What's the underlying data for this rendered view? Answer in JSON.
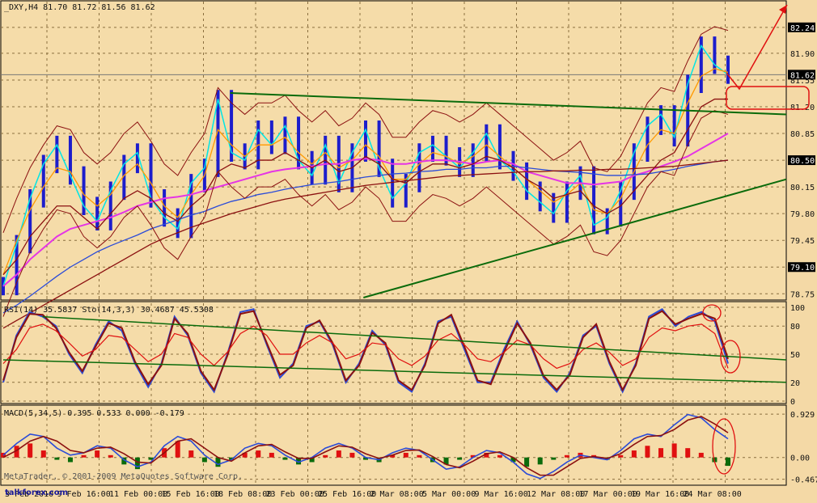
{
  "chart_data": [
    {
      "type": "line",
      "panel": "price",
      "title": "_DXY,H4  81.70 81.72 81.56 81.62",
      "y_ticks": [
        "82.24",
        "81.90",
        "81.55",
        "81.20",
        "80.85",
        "80.50",
        "80.15",
        "79.80",
        "79.45",
        "79.10",
        "78.75"
      ],
      "ylim": [
        78.7,
        82.45
      ],
      "current_price": "81.62",
      "marked_levels": [
        "82.24",
        "81.10",
        "80.50",
        "79.10"
      ],
      "x_labels": [
        "3 Feb 2010",
        "9 Feb 16:00",
        "11 Feb 00:00",
        "15 Feb 16:00",
        "18 Feb 08:00",
        "23 Feb 00:00",
        "25 Feb 16:00",
        "2 Mar 08:00",
        "5 Mar 00:00",
        "9 Mar 16:00",
        "12 Mar 08:00",
        "17 Mar 00:00",
        "19 Mar 16:00",
        "24 Mar 08:00"
      ],
      "series": [
        {
          "values": [
            78.85,
            79.4,
            80.0,
            80.45,
            80.7,
            80.3,
            79.9,
            79.7,
            80.1,
            80.45,
            80.6,
            80.0,
            79.75,
            79.6,
            80.2,
            80.4,
            81.3,
            80.6,
            80.5,
            80.9,
            80.7,
            80.95,
            80.5,
            80.3,
            80.7,
            80.2,
            80.6,
            80.9,
            80.4,
            80.0,
            80.2,
            80.6,
            80.7,
            80.55,
            80.4,
            80.6,
            80.85,
            80.5,
            80.35,
            80.1,
            79.95,
            79.8,
            80.1,
            80.3,
            79.65,
            79.75,
            80.1,
            80.6,
            80.95,
            81.1,
            80.8,
            81.5,
            82.0,
            81.75,
            81.62
          ]
        },
        {
          "values": [
            79.0,
            79.45,
            79.85,
            80.15,
            80.4,
            80.35,
            80.05,
            79.9,
            80.05,
            80.3,
            80.45,
            80.2,
            79.9,
            79.75,
            80.05,
            80.3,
            80.9,
            80.7,
            80.55,
            80.7,
            80.7,
            80.8,
            80.6,
            80.45,
            80.6,
            80.4,
            80.5,
            80.7,
            80.55,
            80.25,
            80.25,
            80.45,
            80.6,
            80.55,
            80.45,
            80.55,
            80.7,
            80.55,
            80.4,
            80.25,
            80.1,
            79.95,
            80.05,
            80.2,
            79.85,
            79.8,
            80.0,
            80.35,
            80.7,
            80.9,
            80.85,
            81.25,
            81.6,
            81.7,
            81.65
          ]
        },
        {
          "values": [
            78.85,
            79.0,
            79.2,
            79.35,
            79.5,
            79.6,
            79.65,
            79.7,
            79.75,
            79.82,
            79.9,
            79.95,
            80.0,
            80.02,
            80.05,
            80.1,
            80.15,
            80.2,
            80.25,
            80.3,
            80.35,
            80.38,
            80.4,
            80.42,
            80.45,
            80.45,
            80.5,
            80.52,
            80.5,
            80.45,
            80.45,
            80.48,
            80.5,
            80.5,
            80.48,
            80.45,
            80.48,
            80.5,
            80.45,
            80.35,
            80.3,
            80.25,
            80.2,
            80.2,
            80.18,
            80.2,
            80.22,
            80.3,
            80.35,
            80.42,
            80.48,
            80.55,
            80.65,
            80.75,
            80.85
          ]
        },
        {
          "values": [
            78.5,
            78.6,
            78.72,
            78.85,
            78.98,
            79.1,
            79.2,
            79.3,
            79.38,
            79.45,
            79.52,
            79.6,
            79.66,
            79.72,
            79.78,
            79.83,
            79.9,
            79.96,
            80.0,
            80.05,
            80.08,
            80.12,
            80.15,
            80.18,
            80.2,
            80.22,
            80.25,
            80.28,
            80.3,
            80.32,
            80.33,
            80.35,
            80.36,
            80.38,
            80.38,
            80.4,
            80.4,
            80.42,
            80.42,
            80.4,
            80.38,
            80.36,
            80.35,
            80.34,
            80.32,
            80.3,
            80.3,
            80.31,
            80.32,
            80.35,
            80.38,
            80.42,
            80.45,
            80.48,
            80.5
          ]
        },
        {
          "values": [
            78.3,
            78.4,
            78.5,
            78.6,
            78.7,
            78.8,
            78.9,
            79.0,
            79.1,
            79.2,
            79.3,
            79.4,
            79.48,
            79.55,
            79.62,
            79.68,
            79.74,
            79.8,
            79.85,
            79.9,
            79.95,
            79.99,
            80.02,
            80.05,
            80.08,
            80.11,
            80.14,
            80.17,
            80.19,
            80.21,
            80.23,
            80.25,
            80.27,
            80.29,
            80.3,
            80.31,
            80.32,
            80.33,
            80.34,
            80.35,
            80.35,
            80.36,
            80.36,
            80.37,
            80.37,
            80.38,
            80.38,
            80.39,
            80.4,
            80.41,
            80.42,
            80.44,
            80.46,
            80.48,
            80.5
          ]
        },
        {
          "values": [
            79.0,
            79.2,
            79.5,
            79.7,
            79.9,
            79.9,
            79.75,
            79.6,
            79.8,
            80.0,
            80.1,
            80.0,
            79.8,
            79.7,
            79.9,
            80.05,
            80.35,
            80.45,
            80.4,
            80.5,
            80.5,
            80.6,
            80.5,
            80.4,
            80.5,
            80.35,
            80.4,
            80.55,
            80.45,
            80.25,
            80.2,
            80.35,
            80.45,
            80.45,
            80.4,
            80.45,
            80.55,
            80.5,
            80.4,
            80.25,
            80.15,
            80.0,
            80.05,
            80.1,
            79.9,
            79.8,
            79.9,
            80.1,
            80.3,
            80.5,
            80.6,
            80.9,
            81.2,
            81.3,
            81.3
          ]
        }
      ],
      "trendlines": [
        {
          "from": [
            0.29,
            81.38
          ],
          "to": [
            1.0,
            81.1
          ]
        },
        {
          "from": [
            0.46,
            78.7
          ],
          "to": [
            1.0,
            80.25
          ]
        }
      ]
    },
    {
      "type": "line",
      "panel": "rsi_stoch",
      "title": "RSI(14) 35.5837  Sto(14,3,3) 30.4687 45.5308",
      "y_ticks": [
        "100",
        "80",
        "50",
        "20",
        "0"
      ],
      "ylim": [
        0,
        100
      ],
      "series": [
        {
          "values": [
            20,
            70,
            95,
            90,
            80,
            50,
            30,
            60,
            85,
            75,
            40,
            15,
            40,
            90,
            70,
            30,
            10,
            50,
            95,
            98,
            60,
            25,
            40,
            80,
            85,
            60,
            20,
            40,
            75,
            60,
            20,
            10,
            40,
            85,
            90,
            55,
            20,
            20,
            55,
            85,
            60,
            25,
            10,
            30,
            70,
            80,
            40,
            10,
            40,
            90,
            98,
            80,
            90,
            95,
            85,
            40
          ]
        },
        {
          "values": [
            22,
            68,
            93,
            92,
            78,
            52,
            32,
            58,
            83,
            78,
            42,
            18,
            38,
            88,
            72,
            32,
            12,
            48,
            93,
            96,
            62,
            28,
            38,
            78,
            86,
            62,
            22,
            38,
            73,
            62,
            22,
            12,
            38,
            83,
            92,
            58,
            22,
            18,
            52,
            83,
            62,
            27,
            12,
            28,
            68,
            82,
            42,
            12,
            38,
            88,
            96,
            82,
            88,
            93,
            88,
            45
          ]
        },
        {
          "values": [
            40,
            55,
            78,
            82,
            75,
            62,
            48,
            55,
            70,
            68,
            55,
            42,
            50,
            72,
            68,
            50,
            38,
            52,
            72,
            80,
            70,
            50,
            50,
            62,
            70,
            62,
            45,
            50,
            62,
            60,
            45,
            38,
            48,
            65,
            72,
            60,
            45,
            42,
            52,
            65,
            60,
            45,
            35,
            40,
            55,
            62,
            52,
            38,
            45,
            68,
            78,
            75,
            80,
            82,
            72,
            35
          ]
        }
      ],
      "trendlines": [
        {
          "from": [
            0.0,
            44
          ],
          "to": [
            1.0,
            20
          ]
        },
        {
          "from": [
            0.05,
            90
          ],
          "to": [
            1.0,
            44
          ]
        }
      ]
    },
    {
      "type": "bar",
      "panel": "macd",
      "title": "MACD(5,34,5) 0.395 0.533 0.000 -0.179",
      "y_ticks": [
        "0.929",
        "0.00",
        "-0.467"
      ],
      "ylim": [
        -0.56,
        1.0
      ],
      "histogram": [
        0.1,
        0.25,
        0.3,
        0.15,
        -0.05,
        -0.1,
        0.05,
        0.15,
        0.05,
        -0.15,
        -0.25,
        -0.05,
        0.2,
        0.35,
        0.15,
        -0.1,
        -0.2,
        -0.05,
        0.1,
        0.15,
        0.1,
        -0.05,
        -0.15,
        -0.1,
        0.05,
        0.15,
        0.1,
        -0.05,
        -0.1,
        0.05,
        0.1,
        0.05,
        -0.1,
        -0.15,
        -0.05,
        0.05,
        0.1,
        0.05,
        -0.1,
        -0.2,
        -0.15,
        -0.05,
        0.05,
        0.1,
        0.05,
        -0.05,
        0.05,
        0.15,
        0.25,
        0.2,
        0.3,
        0.2,
        0.1,
        -0.1,
        -0.18
      ],
      "series": [
        {
          "values": [
            0.05,
            0.3,
            0.5,
            0.45,
            0.2,
            0.05,
            0.1,
            0.25,
            0.2,
            -0.05,
            -0.2,
            -0.1,
            0.25,
            0.45,
            0.35,
            0.05,
            -0.15,
            -0.05,
            0.2,
            0.3,
            0.25,
            0.05,
            -0.1,
            0.0,
            0.2,
            0.3,
            0.2,
            0.0,
            -0.05,
            0.1,
            0.2,
            0.15,
            -0.05,
            -0.25,
            -0.2,
            0.0,
            0.15,
            0.1,
            -0.1,
            -0.35,
            -0.45,
            -0.3,
            -0.1,
            0.05,
            0.0,
            -0.05,
            0.15,
            0.4,
            0.5,
            0.45,
            0.7,
            0.92,
            0.85,
            0.6,
            0.4
          ]
        },
        {
          "values": [
            0.0,
            0.15,
            0.35,
            0.45,
            0.35,
            0.15,
            0.1,
            0.2,
            0.22,
            0.08,
            -0.1,
            -0.12,
            0.1,
            0.35,
            0.4,
            0.2,
            0.0,
            -0.08,
            0.1,
            0.25,
            0.28,
            0.12,
            -0.02,
            -0.02,
            0.12,
            0.25,
            0.22,
            0.08,
            -0.02,
            0.05,
            0.15,
            0.16,
            0.02,
            -0.15,
            -0.22,
            -0.08,
            0.08,
            0.12,
            0.0,
            -0.22,
            -0.38,
            -0.38,
            -0.2,
            -0.02,
            0.02,
            -0.02,
            0.08,
            0.28,
            0.45,
            0.47,
            0.6,
            0.8,
            0.88,
            0.72,
            0.53
          ]
        }
      ]
    }
  ],
  "watermark": {
    "site": "talkforex.com",
    "brand": "MetaTrader, © 2001-2009 MetaQuotes Software Corp."
  },
  "colors": {
    "background": "#f4d9a6",
    "bars": "#1d1dcc",
    "cyan": "#00e5e5",
    "orange": "#ff9900",
    "magenta": "#e535e5",
    "blue": "#2b4bd8",
    "darkred": "#8b1010",
    "green": "#0b6b0b",
    "red": "#e01010"
  }
}
